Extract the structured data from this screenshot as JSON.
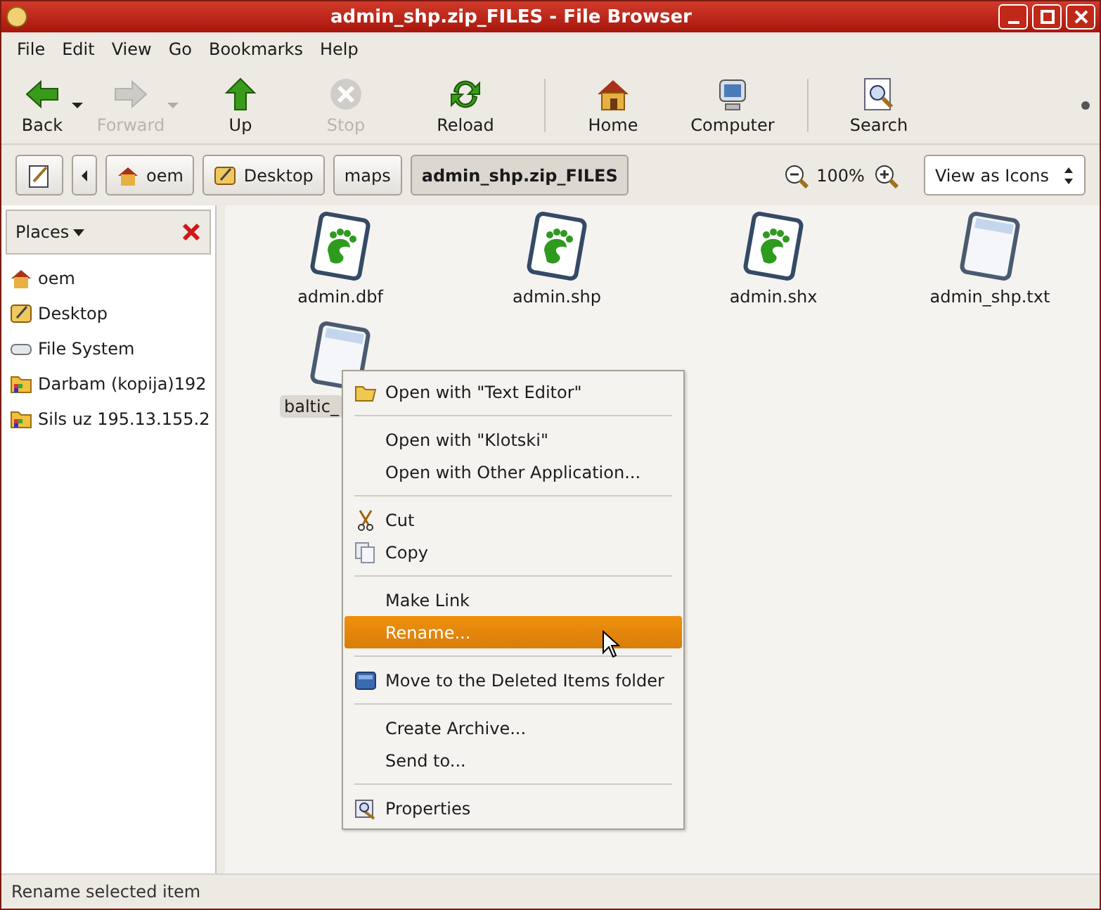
{
  "window": {
    "title": "admin_shp.zip_FILES - File Browser"
  },
  "menubar": [
    "File",
    "Edit",
    "View",
    "Go",
    "Bookmarks",
    "Help"
  ],
  "toolbar": [
    {
      "kind": "back",
      "label": "Back",
      "disabled": false
    },
    {
      "kind": "forward",
      "label": "Forward",
      "disabled": true
    },
    {
      "kind": "up",
      "label": "Up",
      "disabled": false
    },
    {
      "kind": "stop",
      "label": "Stop",
      "disabled": true
    },
    {
      "kind": "reload",
      "label": "Reload",
      "disabled": false
    },
    {
      "kind": "separator"
    },
    {
      "kind": "home",
      "label": "Home",
      "disabled": false
    },
    {
      "kind": "computer",
      "label": "Computer",
      "disabled": false
    },
    {
      "kind": "separator"
    },
    {
      "kind": "search",
      "label": "Search",
      "disabled": false
    }
  ],
  "location": {
    "crumbs": [
      {
        "label": "oem",
        "kind": "home",
        "selected": false
      },
      {
        "label": "Desktop",
        "kind": "desktop",
        "selected": false
      },
      {
        "label": "maps",
        "kind": "plain",
        "selected": false
      },
      {
        "label": "admin_shp.zip_FILES",
        "kind": "plain",
        "selected": true
      }
    ],
    "zoom": "100%",
    "view": "View as Icons"
  },
  "sidebar": {
    "title": "Places",
    "items": [
      {
        "label": "oem",
        "kind": "home"
      },
      {
        "label": "Desktop",
        "kind": "desktop"
      },
      {
        "label": "File System",
        "kind": "drive"
      },
      {
        "label": "Darbam (kopija)192",
        "kind": "network"
      },
      {
        "label": "Sils uz 195.13.155.2",
        "kind": "network"
      }
    ]
  },
  "files": [
    {
      "name": "admin.dbf",
      "kind": "gnome",
      "selected": false
    },
    {
      "name": "admin.shp",
      "kind": "gnome",
      "selected": false
    },
    {
      "name": "admin.shx",
      "kind": "gnome",
      "selected": false
    },
    {
      "name": "admin_shp.txt",
      "kind": "text",
      "selected": false
    },
    {
      "name": "baltic_",
      "kind": "text",
      "selected": true
    }
  ],
  "context_menu": [
    {
      "kind": "item",
      "label": "Open with \"Text Editor\"",
      "selected": false
    },
    {
      "kind": "separator"
    },
    {
      "kind": "item",
      "label": "Open with \"Klotski\"",
      "selected": false
    },
    {
      "kind": "item",
      "label": "Open with Other Application...",
      "selected": false
    },
    {
      "kind": "separator"
    },
    {
      "kind": "item",
      "label": "Cut",
      "selected": false
    },
    {
      "kind": "item",
      "label": "Copy",
      "selected": false
    },
    {
      "kind": "separator"
    },
    {
      "kind": "item",
      "label": "Make Link",
      "selected": false
    },
    {
      "kind": "item",
      "label": "Rename...",
      "selected": true
    },
    {
      "kind": "separator"
    },
    {
      "kind": "item",
      "label": "Move to the Deleted Items folder",
      "selected": false
    },
    {
      "kind": "separator"
    },
    {
      "kind": "item",
      "label": "Create Archive...",
      "selected": false
    },
    {
      "kind": "item",
      "label": "Send to...",
      "selected": false
    },
    {
      "kind": "separator"
    },
    {
      "kind": "item",
      "label": "Properties",
      "selected": false
    }
  ],
  "status_bar": "Rename selected item"
}
